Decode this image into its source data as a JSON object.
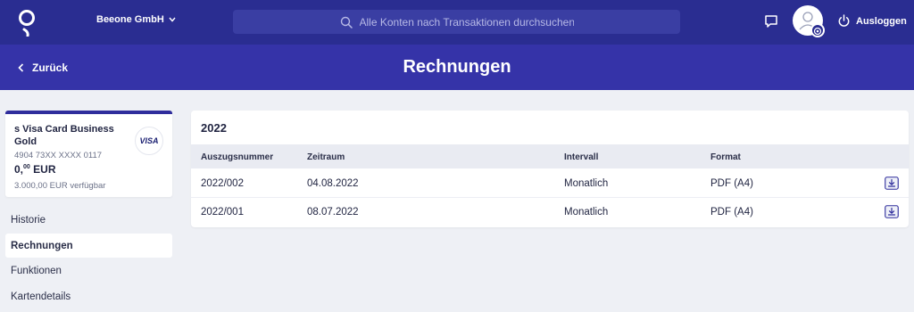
{
  "header": {
    "company": "Beeone GmbH",
    "search_placeholder": "Alle Konten nach Transaktionen durchsuchen",
    "logout_label": "Ausloggen"
  },
  "subheader": {
    "back_label": "Zurück",
    "title": "Rechnungen"
  },
  "card": {
    "name": "s Visa Card Business Gold",
    "brand": "VISA",
    "number": "4904 73XX XXXX 0117",
    "balance_int": "0,",
    "balance_dec": "00",
    "balance_currency": "EUR",
    "available": "3.000,00 EUR verfügbar"
  },
  "sidebar": {
    "items": [
      {
        "label": "Historie",
        "active": false
      },
      {
        "label": "Rechnungen",
        "active": true
      },
      {
        "label": "Funktionen",
        "active": false
      },
      {
        "label": "Kartendetails",
        "active": false
      }
    ]
  },
  "statements": {
    "year": "2022",
    "columns": [
      "Auszugsnummer",
      "Zeitraum",
      "Intervall",
      "Format"
    ],
    "rows": [
      {
        "number": "2022/002",
        "period": "04.08.2022",
        "interval": "Monatlich",
        "format": "PDF (A4)"
      },
      {
        "number": "2022/001",
        "period": "08.07.2022",
        "interval": "Monatlich",
        "format": "PDF (A4)"
      }
    ]
  },
  "colors": {
    "topbar": "#2a2d91",
    "subheader": "#3533a8",
    "background": "#eef0f5",
    "accent": "#2f2d9c"
  },
  "icons": {
    "logo": "brand-logo-icon",
    "search": "search-icon",
    "chevron": "chevron-down-icon",
    "chat": "chat-icon",
    "avatar": "user-icon",
    "settings": "gear-icon",
    "logout": "power-icon",
    "back": "chevron-left-icon",
    "download": "download-icon"
  }
}
